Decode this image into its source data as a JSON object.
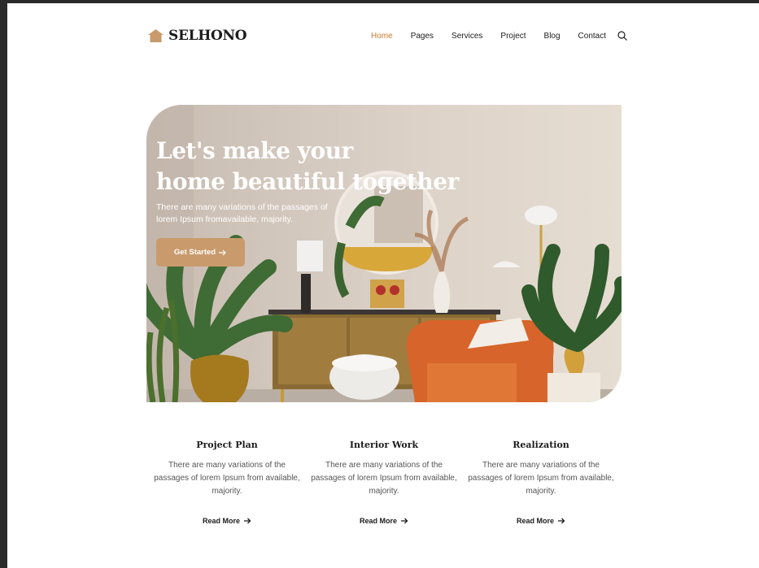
{
  "brand": {
    "name": "SELHONO",
    "icon": "house-icon",
    "accent": "#c99a6c"
  },
  "nav": {
    "items": [
      {
        "label": "Home",
        "active": true
      },
      {
        "label": "Pages"
      },
      {
        "label": "Services"
      },
      {
        "label": "Project"
      },
      {
        "label": "Blog"
      },
      {
        "label": "Contact"
      }
    ],
    "search_icon": "search-icon",
    "active_color": "#c97a2f"
  },
  "hero": {
    "title_line1": "Let's make your",
    "title_line2": "home beautiful together",
    "subtitle": "There are many variations of the passages of lorem Ipsum fromavailable, majority.",
    "cta_label": "Get Started",
    "cta_icon": "arrow-right-icon"
  },
  "features": [
    {
      "title": "Project Plan",
      "text": "There are many variations of the passages of lorem Ipsum from available, majority.",
      "link": "Read More"
    },
    {
      "title": "Interior Work",
      "text": "There are many variations of the passages of lorem Ipsum from available, majority.",
      "link": "Read More"
    },
    {
      "title": "Realization",
      "text": "There are many variations of the passages of lorem Ipsum from available, majority.",
      "link": "Read More"
    }
  ]
}
